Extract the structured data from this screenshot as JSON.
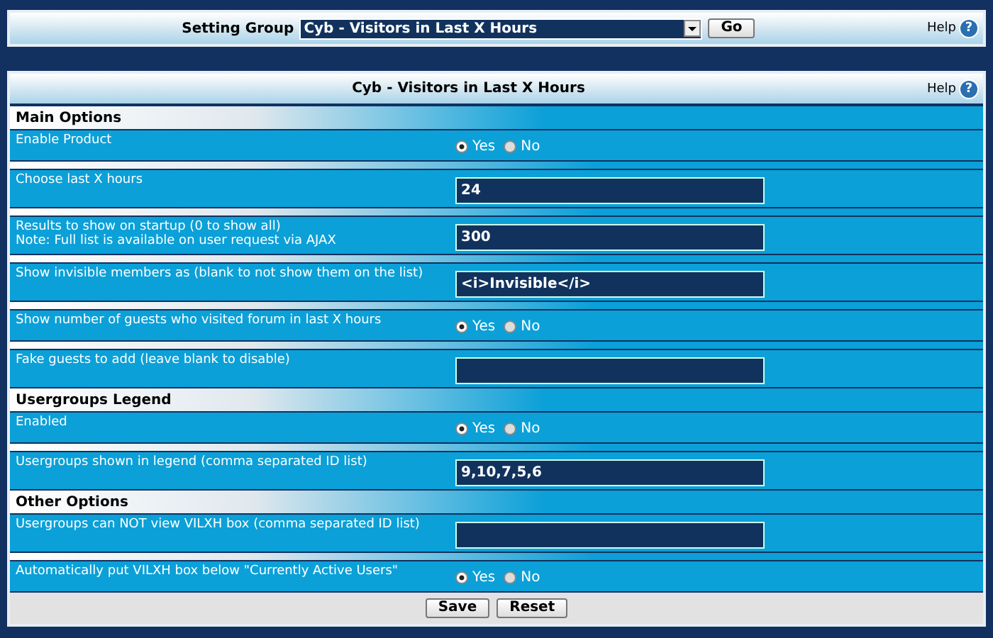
{
  "top_bar": {
    "label": "Setting Group",
    "select_value": "Cyb - Visitors in Last X Hours",
    "go_button": "Go",
    "help": "Help",
    "help_icon": "?"
  },
  "panel": {
    "title": "Cyb - Visitors in Last X Hours",
    "help": "Help",
    "help_icon": "?"
  },
  "sections": [
    {
      "title": "Main Options",
      "rows": [
        {
          "kind": "radio",
          "label": "Enable Product",
          "options": [
            {
              "label": "Yes",
              "selected": true
            },
            {
              "label": "No",
              "selected": false
            }
          ]
        },
        {
          "kind": "text",
          "label": "Choose last X hours",
          "value": "24"
        },
        {
          "kind": "text",
          "label": "Results to show on startup (0 to show all)",
          "note": "Note: Full list is available on user request via AJAX",
          "value": "300"
        },
        {
          "kind": "text",
          "label": "Show invisible members as (blank to not show them on the list)",
          "value": "<i>Invisible</i>"
        },
        {
          "kind": "radio",
          "label": "Show number of guests who visited forum in last X hours",
          "options": [
            {
              "label": "Yes",
              "selected": true
            },
            {
              "label": "No",
              "selected": false
            }
          ]
        },
        {
          "kind": "text",
          "label": "Fake guests to add (leave blank to disable)"
        }
      ]
    },
    {
      "title": "Usergroups Legend",
      "rows": [
        {
          "kind": "radio",
          "label": "Enabled",
          "options": [
            {
              "label": "Yes",
              "selected": true
            },
            {
              "label": "No",
              "selected": false
            }
          ]
        },
        {
          "kind": "text",
          "label": "Usergroups shown in legend (comma separated ID list)",
          "value": "9,10,7,5,6"
        }
      ]
    },
    {
      "title": "Other Options",
      "rows": [
        {
          "kind": "text",
          "label": "Usergroups can NOT view VILXH box (comma separated ID list)"
        },
        {
          "kind": "radio",
          "label": "Automatically put VILXH box below \"Currently Active Users\"",
          "options": [
            {
              "label": "Yes",
              "selected": true
            },
            {
              "label": "No",
              "selected": false
            }
          ]
        }
      ]
    }
  ],
  "buttons": [
    "Save",
    "Reset"
  ]
}
